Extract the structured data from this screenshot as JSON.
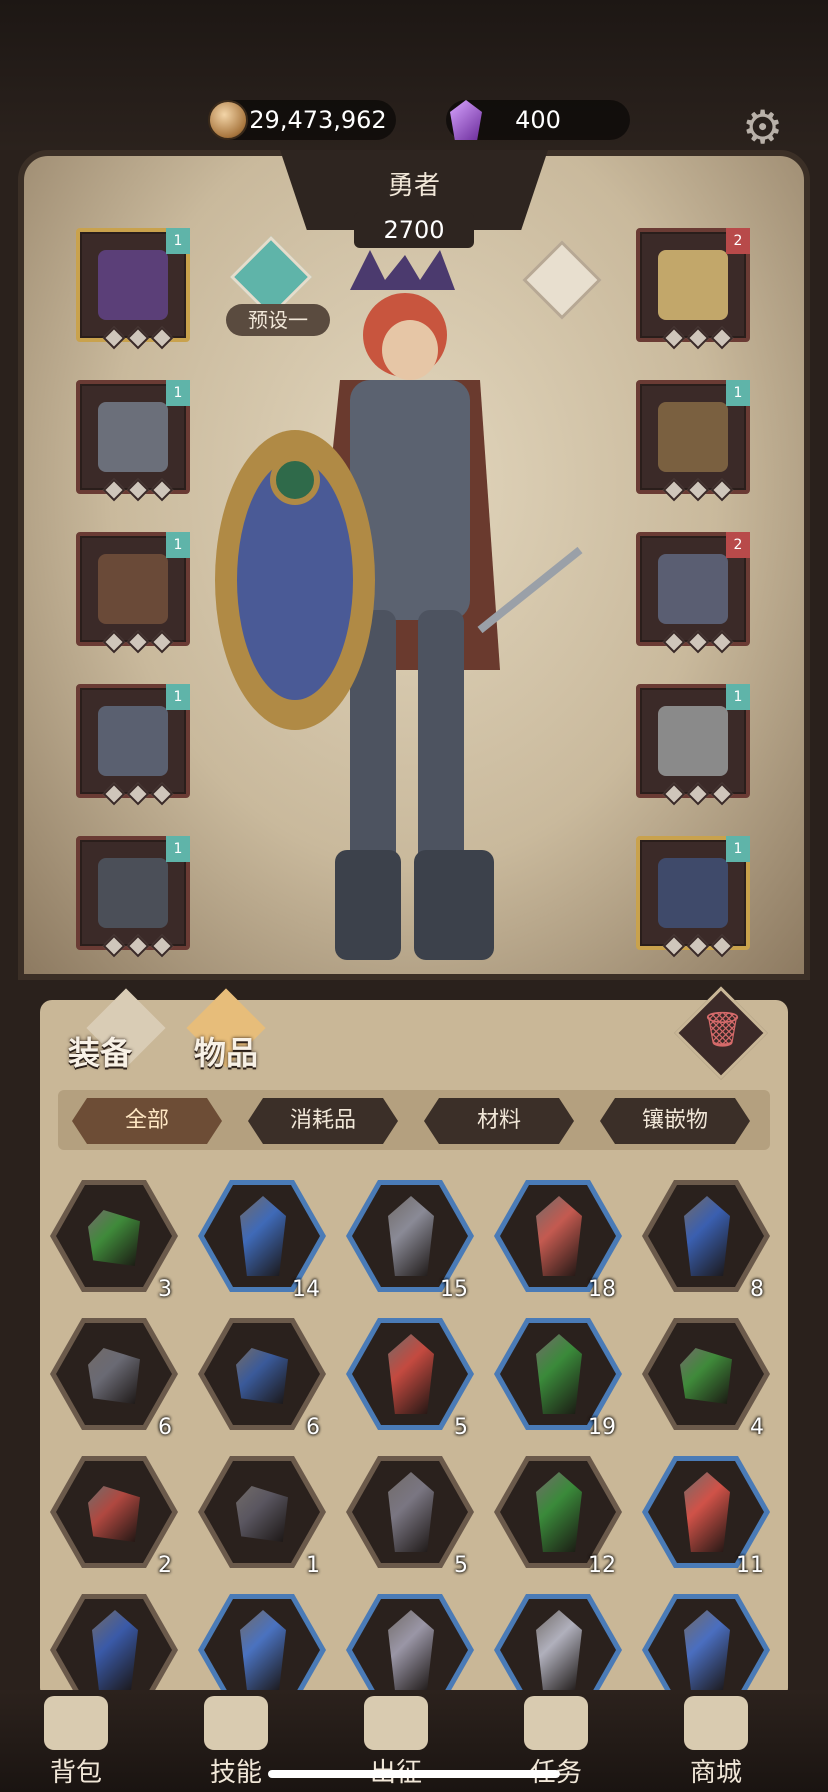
{
  "currency": {
    "gold": "29,473,962",
    "gems": "400"
  },
  "hero": {
    "name": "勇者",
    "power": "2700",
    "preset_label": "预设一"
  },
  "equipment_slots_left": [
    {
      "name": "helmet-slot",
      "tag": "1",
      "tag_color": "#5fb4a9",
      "art_color": "#5b3f78",
      "gold": true
    },
    {
      "name": "armor-slot",
      "tag": "1",
      "tag_color": "#5fb4a9",
      "art_color": "#6b6f7a",
      "gold": false
    },
    {
      "name": "gloves-slot",
      "tag": "1",
      "tag_color": "#5fb4a9",
      "art_color": "#6a4a38",
      "gold": false
    },
    {
      "name": "leggings-slot",
      "tag": "1",
      "tag_color": "#5fb4a9",
      "art_color": "#5a6070",
      "gold": false
    },
    {
      "name": "boots-slot",
      "tag": "1",
      "tag_color": "#5fb4a9",
      "art_color": "#4b4f58",
      "gold": false
    }
  ],
  "equipment_slots_right": [
    {
      "name": "amulet-slot",
      "tag": "2",
      "tag_color": "#b84a4a",
      "art_color": "#c2a76a",
      "gold": false
    },
    {
      "name": "bracelet-slot",
      "tag": "1",
      "tag_color": "#5fb4a9",
      "art_color": "#7a6040",
      "gold": false
    },
    {
      "name": "ring-slot",
      "tag": "2",
      "tag_color": "#b84a4a",
      "art_color": "#5a5e72",
      "gold": false
    },
    {
      "name": "weapon-slot",
      "tag": "1",
      "tag_color": "#5fb4a9",
      "art_color": "#8a8a8a",
      "gold": false
    },
    {
      "name": "shield-slot",
      "tag": "1",
      "tag_color": "#5fb4a9",
      "art_color": "#3f4a6a",
      "gold": true
    }
  ],
  "side_tabs": {
    "equipment": "装备",
    "items": "物品"
  },
  "filter_tabs": [
    "全部",
    "消耗品",
    "材料",
    "镶嵌物"
  ],
  "inventory": [
    {
      "count": "3",
      "color": "#3f8a3a",
      "frame": "dark",
      "shape": "small"
    },
    {
      "count": "14",
      "color": "#3f6ab8",
      "frame": "blue",
      "shape": "large"
    },
    {
      "count": "15",
      "color": "#8a8a96",
      "frame": "blue",
      "shape": "large"
    },
    {
      "count": "18",
      "color": "#c45a50",
      "frame": "blue",
      "shape": "large"
    },
    {
      "count": "8",
      "color": "#3a5fb0",
      "frame": "dark",
      "shape": "large"
    },
    {
      "count": "6",
      "color": "#6a6a74",
      "frame": "dark",
      "shape": "small"
    },
    {
      "count": "6",
      "color": "#3a5a9a",
      "frame": "dark",
      "shape": "small"
    },
    {
      "count": "5",
      "color": "#c44a40",
      "frame": "blue",
      "shape": "large"
    },
    {
      "count": "19",
      "color": "#3a8a3a",
      "frame": "blue",
      "shape": "large"
    },
    {
      "count": "4",
      "color": "#3f8a3a",
      "frame": "dark",
      "shape": "small"
    },
    {
      "count": "2",
      "color": "#b04840",
      "frame": "dark",
      "shape": "small"
    },
    {
      "count": "1",
      "color": "#5a5660",
      "frame": "dark",
      "shape": "small"
    },
    {
      "count": "5",
      "color": "#7a7682",
      "frame": "dark",
      "shape": "large"
    },
    {
      "count": "12",
      "color": "#3a8a3a",
      "frame": "dark",
      "shape": "large"
    },
    {
      "count": "11",
      "color": "#d05248",
      "frame": "blue",
      "shape": "large"
    },
    {
      "count": "",
      "color": "#3a5aa8",
      "frame": "dark",
      "shape": "large"
    },
    {
      "count": "",
      "color": "#4a72c0",
      "frame": "blue",
      "shape": "large"
    },
    {
      "count": "",
      "color": "#9a96a6",
      "frame": "blue",
      "shape": "large"
    },
    {
      "count": "",
      "color": "#b0b0bc",
      "frame": "blue",
      "shape": "large"
    },
    {
      "count": "",
      "color": "#4a6ec0",
      "frame": "blue",
      "shape": "large"
    }
  ],
  "bottom_nav": [
    {
      "name": "nav-backpack",
      "label": "背包",
      "icon": "backpack-icon"
    },
    {
      "name": "nav-skills",
      "label": "技能",
      "icon": "skill-book-icon"
    },
    {
      "name": "nav-expedition",
      "label": "出征",
      "icon": "map-icon"
    },
    {
      "name": "nav-quests",
      "label": "任务",
      "icon": "scroll-icon"
    },
    {
      "name": "nav-shop",
      "label": "商城",
      "icon": "shop-icon"
    }
  ]
}
